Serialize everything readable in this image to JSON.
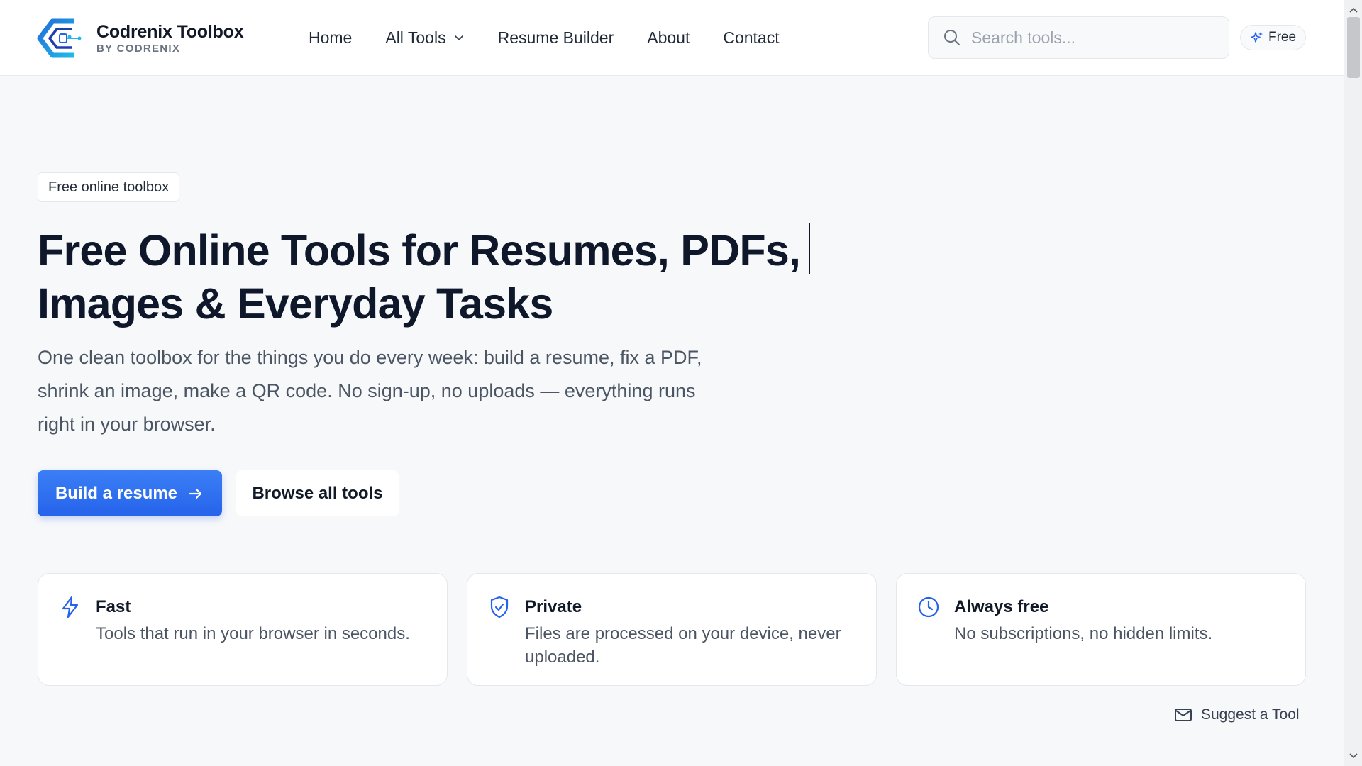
{
  "brand": {
    "name": "Codrenix Toolbox",
    "tagline": "BY CODRENIX",
    "logo_icon": "codrenix-logo-icon"
  },
  "nav": {
    "items": [
      {
        "label": "Home"
      },
      {
        "label": "All Tools",
        "has_dropdown": true
      },
      {
        "label": "Resume Builder"
      },
      {
        "label": "About"
      },
      {
        "label": "Contact"
      }
    ]
  },
  "search": {
    "placeholder": "Search tools...",
    "value": ""
  },
  "badge": {
    "label": "Free",
    "icon": "sparkles-icon"
  },
  "hero": {
    "pill": "Free online toolbox",
    "title_line1": "Free Online Tools for Resumes, PDFs,",
    "title_line2": "Images & Everyday Tasks",
    "description": "One clean toolbox for the things you do every week: build a resume, fix a PDF, shrink an image, make a QR code. No sign-up, no uploads — everything runs right in your browser.",
    "primary_button": "Build a resume",
    "secondary_button": "Browse all tools"
  },
  "features": [
    {
      "title": "Fast",
      "description": "Tools that run in your browser in seconds.",
      "icon": "lightning-icon"
    },
    {
      "title": "Private",
      "description": "Files are processed on your device, never uploaded.",
      "icon": "shield-check-icon"
    },
    {
      "title": "Always free",
      "description": "No subscriptions, no hidden limits.",
      "icon": "clock-icon"
    }
  ],
  "suggest": {
    "label": "Suggest a Tool",
    "icon": "mail-icon"
  },
  "colors": {
    "accent": "#2563eb",
    "text": "#111827",
    "muted": "#4b5563",
    "background": "#f7f8fa"
  }
}
